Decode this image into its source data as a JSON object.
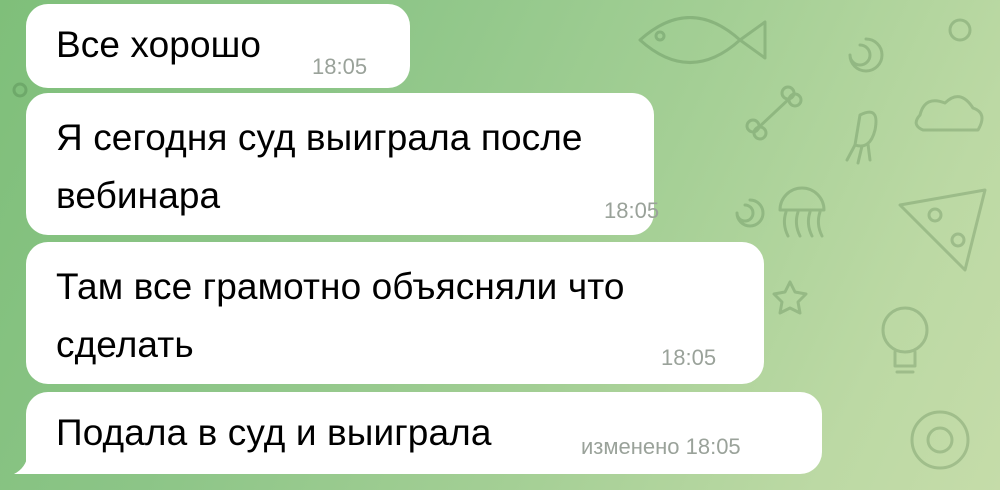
{
  "messages": [
    {
      "text": "Все хорошо",
      "time": "18:05"
    },
    {
      "line1": "Я сегодня суд выиграла после",
      "line2": "вебинара",
      "time": "18:05"
    },
    {
      "line1": "Там все грамотно объясняли что",
      "line2": "сделать",
      "time": "18:05"
    },
    {
      "text": "Подала в суд и выиграла",
      "time": "изменено 18:05"
    }
  ],
  "colors": {
    "bubble": "#ffffff",
    "text": "#000000",
    "time": "#9aa29a",
    "wallpaper_start": "#7fbf7a",
    "wallpaper_end": "#c5dca9"
  },
  "wallpaper_icons": [
    "bone-icon",
    "star-icon",
    "lightbulb-icon",
    "jellyfish-icon",
    "pizza-icon",
    "spiral-icon",
    "fish-icon"
  ]
}
